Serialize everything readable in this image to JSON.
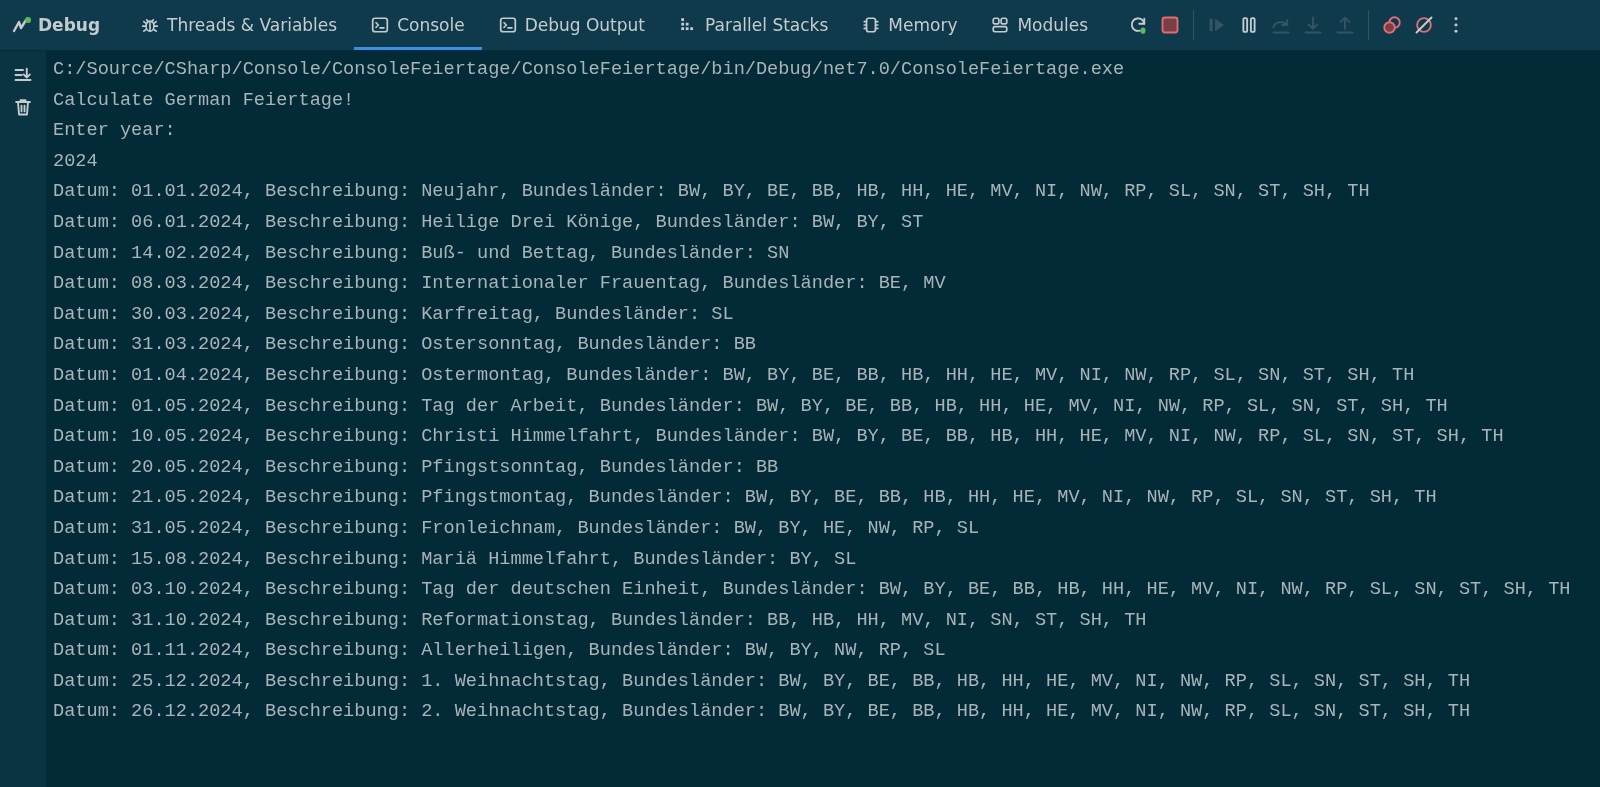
{
  "panel": {
    "title": "Debug"
  },
  "tabs": [
    {
      "label": "Threads & Variables",
      "kind": "bug",
      "selected": false
    },
    {
      "label": "Console",
      "kind": "terminal",
      "selected": true
    },
    {
      "label": "Debug Output",
      "kind": "terminal",
      "selected": false
    },
    {
      "label": "Parallel Stacks",
      "kind": "stacks",
      "selected": false
    },
    {
      "label": "Memory",
      "kind": "chip",
      "selected": false
    },
    {
      "label": "Modules",
      "kind": "modules",
      "selected": false
    }
  ],
  "toolbar": [
    {
      "kind": "rerun",
      "disabled": false
    },
    {
      "kind": "stop",
      "disabled": false
    },
    {
      "kind": "separator"
    },
    {
      "kind": "resume",
      "disabled": true
    },
    {
      "kind": "pause",
      "disabled": false
    },
    {
      "kind": "step-over",
      "disabled": true
    },
    {
      "kind": "step-into",
      "disabled": true
    },
    {
      "kind": "step-out",
      "disabled": true
    },
    {
      "kind": "separator"
    },
    {
      "kind": "breakpoints",
      "disabled": false
    },
    {
      "kind": "mute",
      "disabled": false
    },
    {
      "kind": "more",
      "disabled": false
    }
  ],
  "side_tools": [
    {
      "kind": "scroll-end"
    },
    {
      "kind": "trash"
    }
  ],
  "console_lines": [
    "C:/Source/CSharp/Console/ConsoleFeiertage/ConsoleFeiertage/bin/Debug/net7.0/ConsoleFeiertage.exe",
    "Calculate German Feiertage!",
    "Enter year:",
    "2024",
    "Datum: 01.01.2024, Beschreibung: Neujahr, Bundesländer: BW, BY, BE, BB, HB, HH, HE, MV, NI, NW, RP, SL, SN, ST, SH, TH",
    "Datum: 06.01.2024, Beschreibung: Heilige Drei Könige, Bundesländer: BW, BY, ST",
    "Datum: 14.02.2024, Beschreibung: Buß- und Bettag, Bundesländer: SN",
    "Datum: 08.03.2024, Beschreibung: Internationaler Frauentag, Bundesländer: BE, MV",
    "Datum: 30.03.2024, Beschreibung: Karfreitag, Bundesländer: SL",
    "Datum: 31.03.2024, Beschreibung: Ostersonntag, Bundesländer: BB",
    "Datum: 01.04.2024, Beschreibung: Ostermontag, Bundesländer: BW, BY, BE, BB, HB, HH, HE, MV, NI, NW, RP, SL, SN, ST, SH, TH",
    "Datum: 01.05.2024, Beschreibung: Tag der Arbeit, Bundesländer: BW, BY, BE, BB, HB, HH, HE, MV, NI, NW, RP, SL, SN, ST, SH, TH",
    "Datum: 10.05.2024, Beschreibung: Christi Himmelfahrt, Bundesländer: BW, BY, BE, BB, HB, HH, HE, MV, NI, NW, RP, SL, SN, ST, SH, TH",
    "Datum: 20.05.2024, Beschreibung: Pfingstsonntag, Bundesländer: BB",
    "Datum: 21.05.2024, Beschreibung: Pfingstmontag, Bundesländer: BW, BY, BE, BB, HB, HH, HE, MV, NI, NW, RP, SL, SN, ST, SH, TH",
    "Datum: 31.05.2024, Beschreibung: Fronleichnam, Bundesländer: BW, BY, HE, NW, RP, SL",
    "Datum: 15.08.2024, Beschreibung: Mariä Himmelfahrt, Bundesländer: BY, SL",
    "Datum: 03.10.2024, Beschreibung: Tag der deutschen Einheit, Bundesländer: BW, BY, BE, BB, HB, HH, HE, MV, NI, NW, RP, SL, SN, ST, SH, TH",
    "Datum: 31.10.2024, Beschreibung: Reformationstag, Bundesländer: BB, HB, HH, MV, NI, SN, ST, SH, TH",
    "Datum: 01.11.2024, Beschreibung: Allerheiligen, Bundesländer: BW, BY, NW, RP, SL",
    "Datum: 25.12.2024, Beschreibung: 1. Weihnachtstag, Bundesländer: BW, BY, BE, BB, HB, HH, HE, MV, NI, NW, RP, SL, SN, ST, SH, TH",
    "Datum: 26.12.2024, Beschreibung: 2. Weihnachtstag, Bundesländer: BW, BY, BE, BB, HB, HH, HE, MV, NI, NW, RP, SL, SN, ST, SH, TH"
  ]
}
